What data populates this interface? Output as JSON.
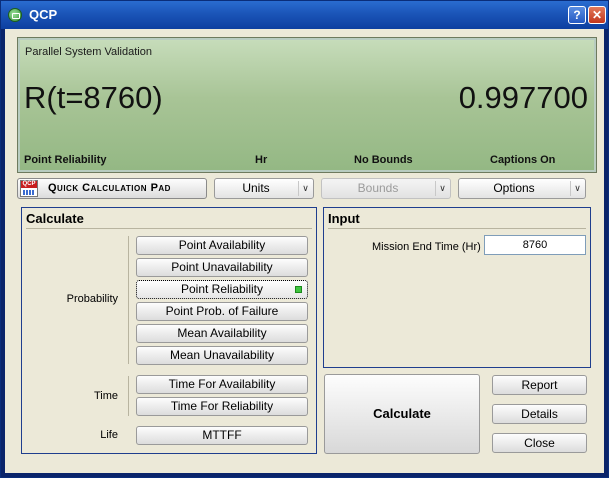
{
  "window": {
    "title": "QCP",
    "help_label": "?",
    "close_label": "✕"
  },
  "display": {
    "caption": "Parallel System Validation",
    "expression": "R(t=8760)",
    "value": "0.997700",
    "status": [
      "Point Reliability",
      "Hr",
      "No Bounds",
      "Captions On"
    ]
  },
  "toolbar": {
    "qcp_label": "Quick Calculation Pad",
    "qcp_icon_tag": "QCP",
    "units_label": "Units",
    "bounds_label": "Bounds",
    "options_label": "Options"
  },
  "calculate": {
    "title": "Calculate",
    "probability_label": "Probability",
    "time_label": "Time",
    "life_label": "Life",
    "probability_buttons": [
      "Point Availability",
      "Point Unavailability",
      "Point Reliability",
      "Point Prob. of Failure",
      "Mean Availability",
      "Mean Unavailability"
    ],
    "selected": "Point Reliability",
    "time_buttons": [
      "Time For Availability",
      "Time For Reliability"
    ],
    "life_buttons": [
      "MTTFF"
    ]
  },
  "input": {
    "title": "Input",
    "mission_end_label": "Mission End Time (Hr)",
    "mission_end_value": "8760"
  },
  "actions": {
    "calculate_label": "Calculate",
    "report_label": "Report",
    "details_label": "Details",
    "close_label": "Close"
  },
  "colors": {
    "title_bar": "#1b55b8",
    "display_green": "#a8c496",
    "group_border": "#1f3e8e",
    "led": "#3fc43f"
  }
}
